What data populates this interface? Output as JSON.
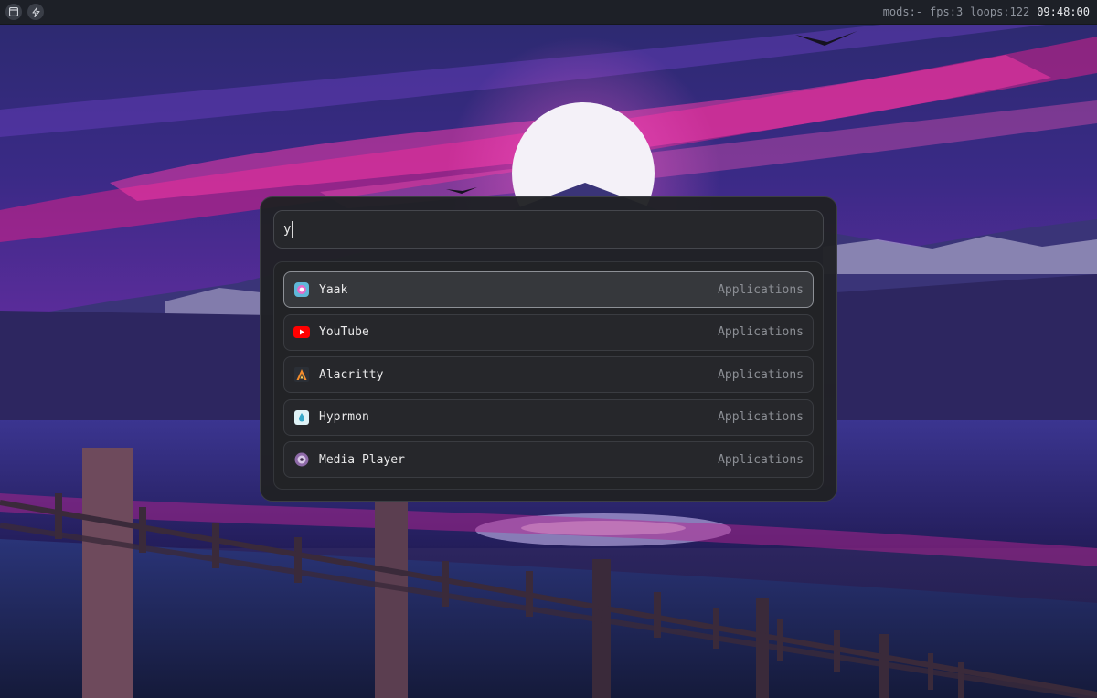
{
  "topbar": {
    "left_icons": [
      "window-icon",
      "lightning-icon"
    ],
    "mods": "mods:-",
    "fps": "fps:3",
    "loops": "loops:122",
    "clock": "09:48:00"
  },
  "launcher": {
    "search": {
      "value": "y"
    },
    "results": [
      {
        "name": "Yaak",
        "category": "Applications",
        "icon": "yaak-icon",
        "selected": true
      },
      {
        "name": "YouTube",
        "category": "Applications",
        "icon": "youtube-icon",
        "selected": false
      },
      {
        "name": "Alacritty",
        "category": "Applications",
        "icon": "alacritty-icon",
        "selected": false
      },
      {
        "name": "Hyprmon",
        "category": "Applications",
        "icon": "hyprmon-icon",
        "selected": false
      },
      {
        "name": "Media Player",
        "category": "Applications",
        "icon": "media-player-icon",
        "selected": false
      }
    ]
  },
  "colors": {
    "topbar_bg": "#1d2027",
    "launcher_bg": "#202124",
    "selected_border": "#8d9096",
    "sky_pink": "#e0268e",
    "sky_purple": "#3d2a8c"
  }
}
